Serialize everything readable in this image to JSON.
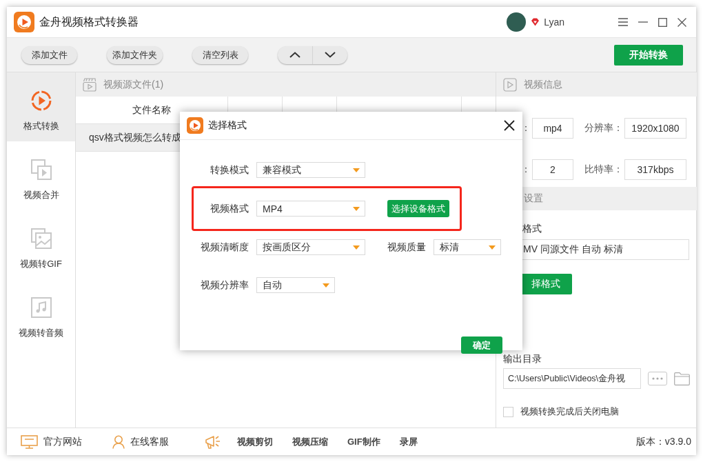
{
  "window": {
    "title": "金舟视频格式转换器",
    "user": "Lyan"
  },
  "toolbar": {
    "buttons": [
      "添加文件",
      "添加文件夹",
      "清空列表"
    ],
    "start_button": "开始转换"
  },
  "sidebar": {
    "items": [
      {
        "label": "格式转换",
        "selected": true
      },
      {
        "label": "视频合并",
        "selected": false
      },
      {
        "label": "视频转GIF",
        "selected": false
      },
      {
        "label": "视频转音频",
        "selected": false
      }
    ]
  },
  "source_panel": {
    "title": "视频源文件(1)",
    "columns": [
      "文件名称"
    ],
    "rows": [
      {
        "file_name": "qsv格式视频怎么转成"
      }
    ]
  },
  "info_panel": {
    "title": "视频信息",
    "fields": [
      {
        "label": "：",
        "value": "mp4"
      },
      {
        "label": "分辨率：",
        "value": "1920x1080"
      },
      {
        "label": "：",
        "value": "2"
      },
      {
        "label": "比特率：",
        "value": "317kbps"
      }
    ]
  },
  "output_panel": {
    "title": "设置",
    "format_label": "格式",
    "format_value": "MV 同源文件 自动 标清",
    "choose_button": "择格式",
    "dir_label": "输出目录",
    "dir_path": "C:\\Users\\Public\\Videos\\金舟视",
    "shutdown": {
      "label": "视频转换完成后关闭电脑",
      "checked": false
    }
  },
  "bottom_bar": {
    "links": [
      "官方网站",
      "在线客服"
    ],
    "tools": [
      "视频剪切",
      "视频压缩",
      "GIF制作",
      "录屏"
    ],
    "version": "版本：v3.9.0"
  },
  "dialog": {
    "title": "选择格式",
    "rows": [
      {
        "highlighted": false,
        "fields": [
          {
            "label": "转换模式",
            "value": "兼容模式"
          }
        ]
      },
      {
        "highlighted": true,
        "fields": [
          {
            "label": "视频格式",
            "value": "MP4"
          }
        ],
        "button": "选择设备格式"
      },
      {
        "highlighted": false,
        "fields": [
          {
            "label": "视频清晰度",
            "value": "按画质区分"
          },
          {
            "label": "视频质量",
            "value": "标清"
          }
        ]
      },
      {
        "highlighted": false,
        "fields": [
          {
            "label": "视频分辨率",
            "value": "自动"
          }
        ]
      }
    ],
    "confirm_button": "确定"
  }
}
